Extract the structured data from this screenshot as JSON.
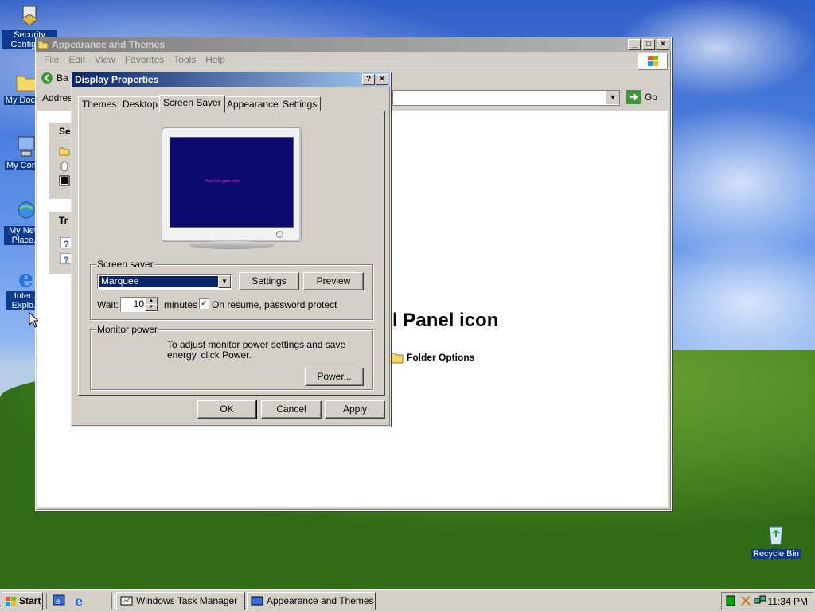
{
  "desktop": {
    "icons": [
      {
        "label": "Security Configu..."
      },
      {
        "label": "My Docu..."
      },
      {
        "label": "My Com..."
      },
      {
        "label": "My Net... Place..."
      },
      {
        "label": "Inter... Explo..."
      },
      {
        "label": "Recycle Bin"
      }
    ]
  },
  "explorer": {
    "title": "Appearance and Themes",
    "menu": [
      "File",
      "Edit",
      "View",
      "Favorites",
      "Tools",
      "Help"
    ],
    "back_label": "Ba",
    "address_label": "Addres",
    "go_label": "Go",
    "side_box1_title": "Se",
    "side_box2_title": "Tr",
    "heading_fragment": "l Panel icon",
    "folder_options_label": "Folder Options"
  },
  "dialog": {
    "title": "Display Properties",
    "help_btn": "?",
    "close_btn": "X",
    "tabs": [
      "Themes",
      "Desktop",
      "Screen Saver",
      "Appearance",
      "Settings"
    ],
    "selected_tab": "Screen Saver",
    "preview_text": "Your text goes here",
    "screensaver": {
      "group_title": "Screen saver",
      "selected": "Marquee",
      "settings_label": "Settings",
      "preview_label": "Preview",
      "wait_label": "Wait:",
      "wait_value": "10",
      "minutes_label": "minutes",
      "password_label": "On resume, password protect",
      "password_checked": true
    },
    "monitor_power": {
      "group_title": "Monitor power",
      "description": "To adjust monitor power settings and save energy, click Power.",
      "power_label": "Power..."
    },
    "ok_label": "OK",
    "cancel_label": "Cancel",
    "apply_label": "Apply"
  },
  "taskbar": {
    "start_label": "Start",
    "tasks": [
      "Windows Task Manager",
      "Appearance and Themes"
    ],
    "clock": "11:34 PM"
  },
  "colors": {
    "title_active": "#0a246a",
    "preview_screen": "#0b0a6e",
    "preview_text": "#ff33cc"
  }
}
